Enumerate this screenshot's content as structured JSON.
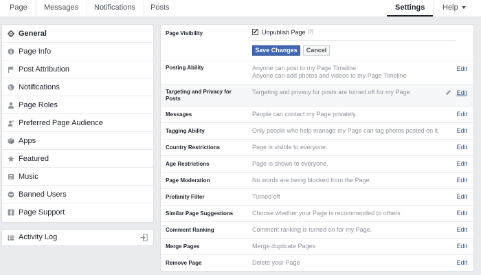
{
  "topnav": {
    "tabs": [
      "Page",
      "Messages",
      "Notifications",
      "Posts"
    ],
    "settings": "Settings",
    "help": "Help"
  },
  "sidebar": {
    "items": [
      {
        "label": "General",
        "icon": "gear-icon"
      },
      {
        "label": "Page Info",
        "icon": "info-icon"
      },
      {
        "label": "Post Attribution",
        "icon": "flag-icon"
      },
      {
        "label": "Notifications",
        "icon": "globe-icon"
      },
      {
        "label": "Page Roles",
        "icon": "person-icon"
      },
      {
        "label": "Preferred Page Audience",
        "icon": "people-icon"
      },
      {
        "label": "Apps",
        "icon": "cube-icon"
      },
      {
        "label": "Featured",
        "icon": "star-icon"
      },
      {
        "label": "Music",
        "icon": "music-icon"
      },
      {
        "label": "Banned Users",
        "icon": "banned-icon"
      },
      {
        "label": "Page Support",
        "icon": "support-icon"
      }
    ],
    "activity_log": "Activity Log"
  },
  "visibility": {
    "label": "Page Visibility",
    "checkbox_label": "Unpublish Page",
    "help": "[?]",
    "checked": true,
    "save": "Save Changes",
    "cancel": "Cancel"
  },
  "settings_rows": [
    {
      "label": "Posting Ability",
      "value": "Anyone can post to my Page Timeline",
      "value2": "Anyone can add photos and videos to my Page Timeline",
      "edit": "Edit"
    },
    {
      "label": "Targeting and Privacy for Posts",
      "value": "Targeting and privacy for posts are turned off for my Page",
      "edit": "Edit"
    },
    {
      "label": "Messages",
      "value": "People can contact my Page privately.",
      "edit": "Edit"
    },
    {
      "label": "Tagging Ability",
      "value": "Only people who help manage my Page can tag photos posted on it.",
      "edit": "Edit"
    },
    {
      "label": "Country Restrictions",
      "value": "Page is visible to everyone.",
      "edit": "Edit"
    },
    {
      "label": "Age Restrictions",
      "value": "Page is shown to everyone.",
      "edit": "Edit"
    },
    {
      "label": "Page Moderation",
      "value": "No words are being blocked from the Page.",
      "edit": "Edit"
    },
    {
      "label": "Profanity Filter",
      "value": "Turned off",
      "edit": "Edit"
    },
    {
      "label": "Similar Page Suggestions",
      "value": "Choose whether your Page is recommended to others",
      "edit": "Edit"
    },
    {
      "label": "Comment Ranking",
      "value": "Comment ranking is turned on for my Page.",
      "edit": "Edit"
    },
    {
      "label": "Merge Pages",
      "value": "Merge duplicate Pages",
      "edit": "Edit"
    },
    {
      "label": "Remove Page",
      "value": "Delete your Page",
      "edit": "Edit"
    }
  ],
  "colors": {
    "background": "#e9ebee",
    "link": "#365899",
    "button": "#4267b2",
    "muted_text": "#90949c"
  }
}
